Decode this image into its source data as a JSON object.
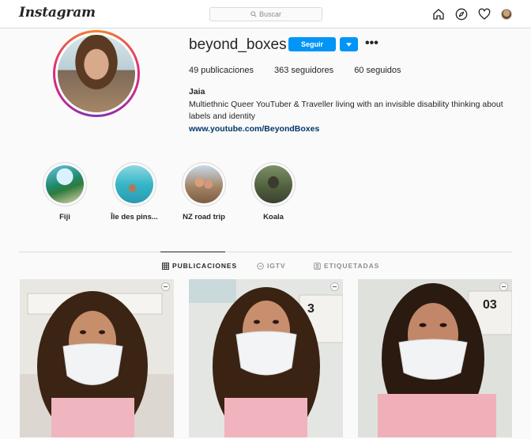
{
  "header": {
    "logo": "Instagram",
    "search_placeholder": "Buscar",
    "icons": [
      "home-icon",
      "explore-icon",
      "heart-icon",
      "profile-avatar"
    ]
  },
  "profile": {
    "username": "beyond_boxes",
    "follow_label": "Seguir",
    "stats": {
      "posts": "49 publicaciones",
      "followers": "363 seguidores",
      "following": "60 seguidos"
    },
    "full_name": "Jaia",
    "bio": "Multiethnic Queer YouTuber & Traveller living with an invisible disability thinking about labels and identity",
    "website": "www.youtube.com/BeyondBoxes"
  },
  "highlights": [
    {
      "label": "Fiji"
    },
    {
      "label": "Île des pins..."
    },
    {
      "label": "NZ road trip"
    },
    {
      "label": "Koala"
    }
  ],
  "tabs": [
    {
      "label": "PUBLICACIONES",
      "active": true
    },
    {
      "label": "IGTV",
      "active": false
    },
    {
      "label": "ETIQUETADAS",
      "active": false
    }
  ],
  "posts": [
    {
      "number_text": ""
    },
    {
      "number_text": "3"
    },
    {
      "number_text": "03"
    }
  ],
  "colors": {
    "accent": "#0095f6",
    "link": "#00376b",
    "text": "#262626",
    "muted": "#8e8e8e",
    "border": "#dbdbdb"
  }
}
